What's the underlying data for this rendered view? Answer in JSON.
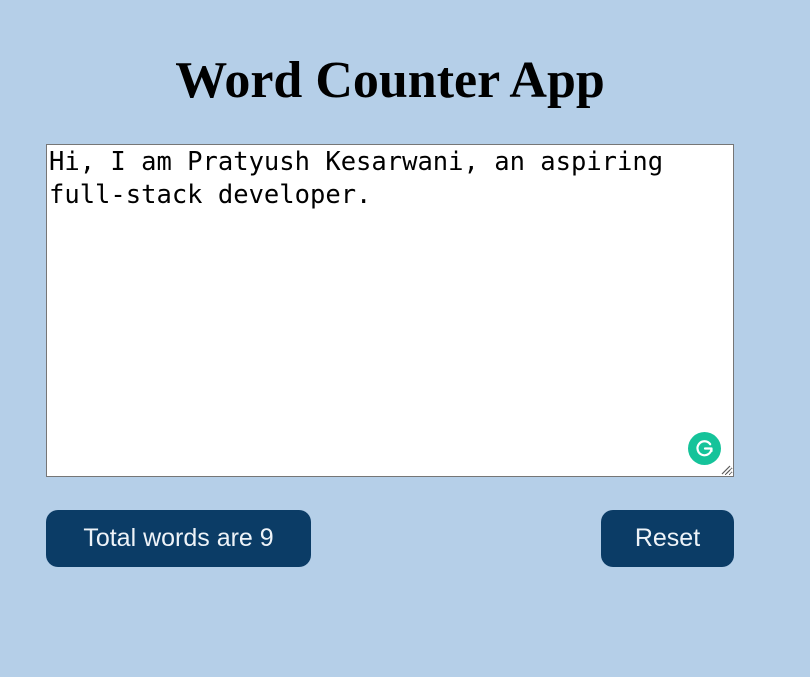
{
  "app": {
    "title": "Word Counter App"
  },
  "editor": {
    "value": "Hi, I am Pratyush Kesarwani, an aspiring full-stack developer."
  },
  "actions": {
    "count_label": "Total words are 9",
    "reset_label": "Reset"
  },
  "colors": {
    "background": "#b5cfe8",
    "button": "#0b3c66",
    "button_text": "#eef3f8",
    "grammarly": "#15c39a"
  },
  "icons": {
    "grammarly": "grammarly-icon",
    "resize": "resize-handle-icon"
  }
}
